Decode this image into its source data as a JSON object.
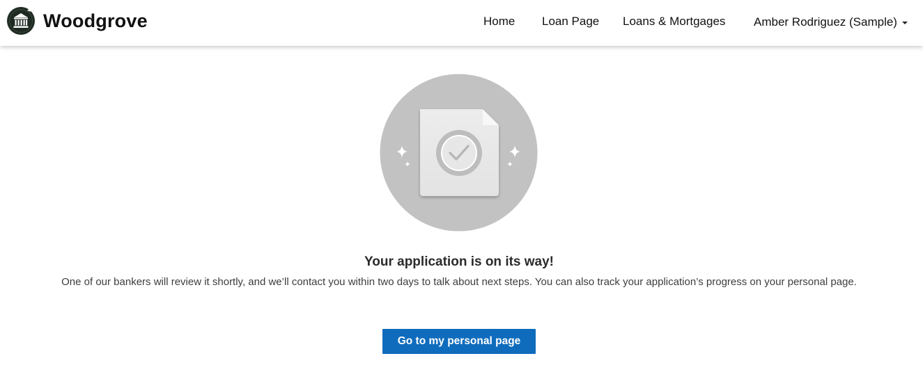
{
  "header": {
    "brand_name": "Woodgrove",
    "nav": {
      "home": "Home",
      "loan_page": "Loan Page",
      "loans_mortgages": "Loans & Mortgages",
      "user_menu": "Amber Rodriguez (Sample)"
    }
  },
  "main": {
    "title": "Your application is on its way!",
    "message": "One of our bankers will review it shortly, and we’ll contact you within two days to talk about next steps. You can also track your application’s progress on your personal page.",
    "cta_label": "Go to my personal page"
  },
  "icons": {
    "logo": "bank-building-icon",
    "user_menu": "chevron-down-icon",
    "hero": "document-check-icon"
  },
  "colors": {
    "accent": "#0f6cbd",
    "logo_dark": "#1e2a22",
    "hero_circle": "#c2c2c2"
  }
}
